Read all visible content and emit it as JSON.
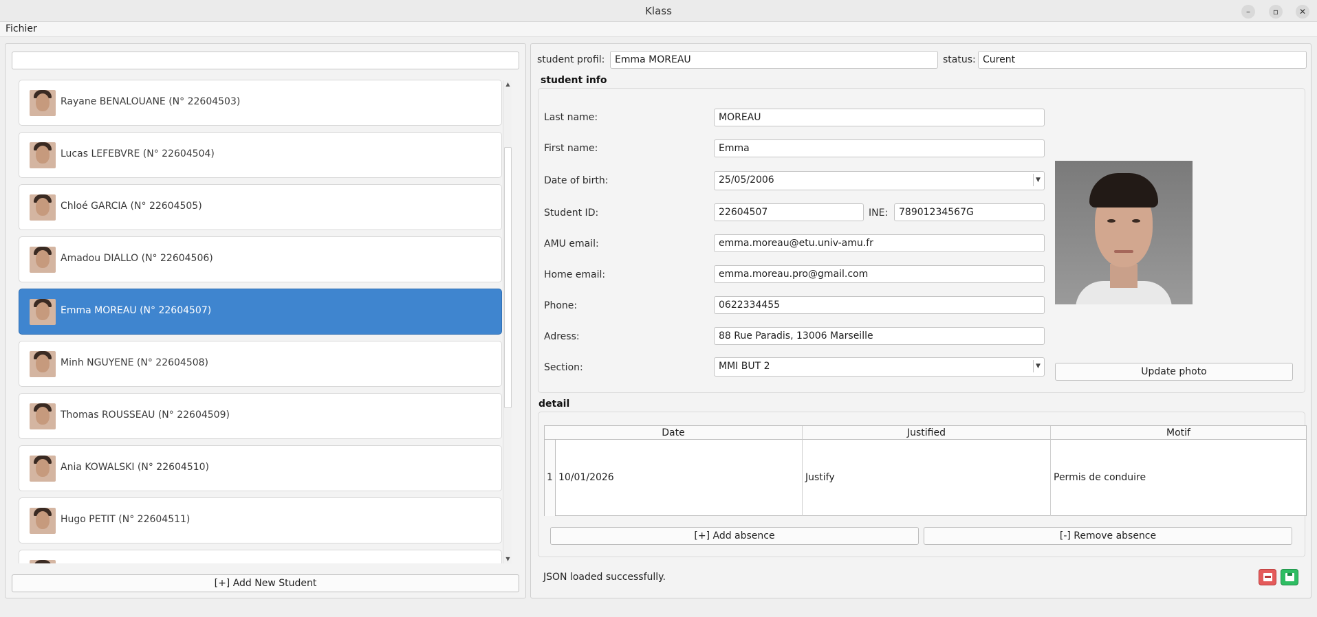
{
  "window": {
    "title": "Klass",
    "minimize_glyph": "–",
    "maximize_glyph": "▫",
    "close_glyph": "✕"
  },
  "menu": {
    "file": "Fichier"
  },
  "left": {
    "search_value": "",
    "students": [
      {
        "label": "Rayane BENALOUANE (N° 22604503)"
      },
      {
        "label": "Lucas LEFEBVRE (N° 22604504)"
      },
      {
        "label": "Chloé GARCIA (N° 22604505)"
      },
      {
        "label": "Amadou DIALLO (N° 22604506)"
      },
      {
        "label": "Emma MOREAU (N° 22604507)"
      },
      {
        "label": "Minh NGUYENE (N° 22604508)"
      },
      {
        "label": "Thomas ROUSSEAU (N° 22604509)"
      },
      {
        "label": "Ania KOWALSKI (N° 22604510)"
      },
      {
        "label": "Hugo PETIT (N° 22604511)"
      }
    ],
    "selected_index": 4,
    "add_button": "[+] Add New Student"
  },
  "profile": {
    "label": "student profil:",
    "value": "Emma MOREAU",
    "status_label": "status:",
    "status_value": "Curent"
  },
  "info": {
    "title": "student info",
    "last_name_label": "Last name:",
    "last_name": "MOREAU",
    "first_name_label": "First name:",
    "first_name": "Emma",
    "dob_label": "Date of birth:",
    "dob": "25/05/2006",
    "student_id_label": "Student ID:",
    "student_id": "22604507",
    "ine_label": "INE:",
    "ine": "78901234567G",
    "amu_email_label": "AMU email:",
    "amu_email": "emma.moreau@etu.univ-amu.fr",
    "home_email_label": "Home email:",
    "home_email": "emma.moreau.pro@gmail.com",
    "phone_label": "Phone:",
    "phone": "0622334455",
    "address_label": "Adress:",
    "address": "88 Rue Paradis, 13006 Marseille",
    "section_label": "Section:",
    "section": "MMI BUT 2",
    "update_photo": "Update photo"
  },
  "detail": {
    "title": "detail",
    "columns": [
      "Date",
      "Justified",
      "Motif"
    ],
    "rows": [
      {
        "num": "1",
        "date": "10/01/2026",
        "justified": "Justify",
        "motif": "Permis de conduire"
      }
    ],
    "add_absence": "[+] Add absence",
    "remove_absence": "[-] Remove absence"
  },
  "status_bar": {
    "message": "JSON loaded successfully."
  },
  "colors": {
    "selection": "#3f85cf",
    "danger": "#e45a5a",
    "success": "#2fbd63"
  }
}
